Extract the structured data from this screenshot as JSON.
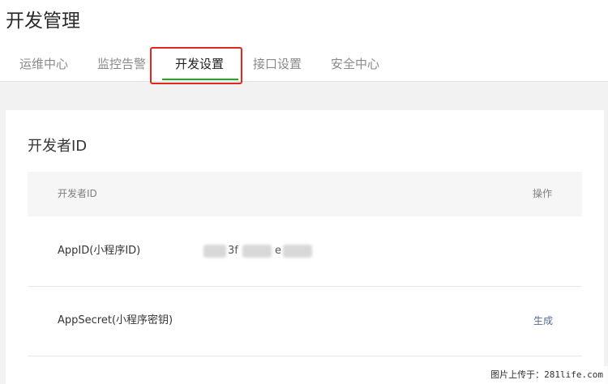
{
  "header": {
    "title": "开发管理"
  },
  "tabs": [
    {
      "label": "运维中心"
    },
    {
      "label": "监控告警"
    },
    {
      "label": "开发设置"
    },
    {
      "label": "接口设置"
    },
    {
      "label": "安全中心"
    }
  ],
  "active_tab": "开发设置",
  "card": {
    "title": "开发者ID",
    "table": {
      "col_id": "开发者ID",
      "col_action": "操作"
    },
    "rows": [
      {
        "label": "AppID(小程序ID)",
        "value_fragment_1": "3f",
        "value_fragment_2": "e",
        "action": ""
      },
      {
        "label": "AppSecret(小程序密钥)",
        "action": "生成"
      }
    ]
  },
  "watermark": "图片上传于：281life.com",
  "colors": {
    "active_underline": "#1aad19",
    "highlight_box": "#e0281e",
    "link": "#576b95"
  }
}
